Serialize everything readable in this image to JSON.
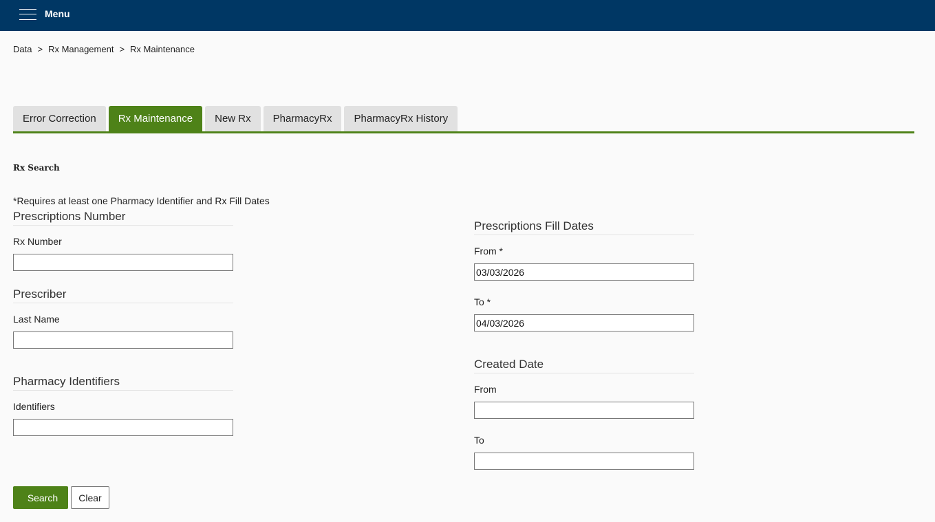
{
  "header": {
    "menu_label": "Menu"
  },
  "breadcrumb": {
    "items": [
      "Data",
      "Rx Management",
      "Rx Maintenance"
    ],
    "separator": ">"
  },
  "tabs": [
    {
      "label": "Error Correction",
      "active": false
    },
    {
      "label": "Rx Maintenance",
      "active": true
    },
    {
      "label": "New Rx",
      "active": false
    },
    {
      "label": "PharmacyRx",
      "active": false
    },
    {
      "label": "PharmacyRx History",
      "active": false
    }
  ],
  "search": {
    "title": "Rx Search",
    "requirement_note": "*Requires at least one Pharmacy Identifier and Rx Fill Dates",
    "prescriptions_number": {
      "heading": "Prescriptions Number",
      "rx_number_label": "Rx Number",
      "rx_number_value": ""
    },
    "prescriber": {
      "heading": "Prescriber",
      "last_name_label": "Last Name",
      "last_name_value": ""
    },
    "pharmacy_identifiers": {
      "heading": "Pharmacy Identifiers",
      "identifiers_label": "Identifiers",
      "identifiers_value": ""
    },
    "fill_dates": {
      "heading": "Prescriptions Fill Dates",
      "from_label": "From *",
      "from_value": "03/03/2026",
      "to_label": "To *",
      "to_value": "04/03/2026"
    },
    "created_date": {
      "heading": "Created Date",
      "from_label": "From",
      "from_value": "",
      "to_label": "To",
      "to_value": ""
    },
    "buttons": {
      "search_icon": "search-icon",
      "search_icon_glyph": "",
      "search_label": "Search",
      "clear_label": "Clear"
    }
  },
  "colors": {
    "header_bg": "#003764",
    "accent_green": "#4e8218",
    "tab_inactive_bg": "#e1e1e1"
  }
}
